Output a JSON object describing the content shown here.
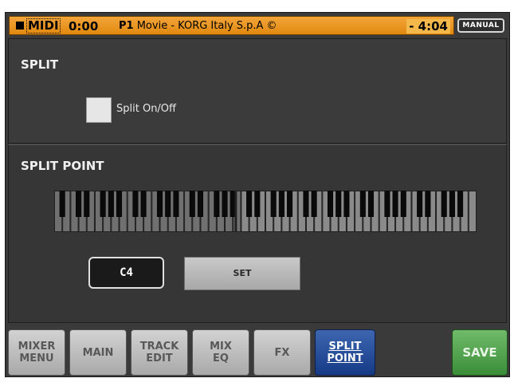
{
  "header": {
    "mode": "MIDI",
    "time": "0:00",
    "song_number": "P1",
    "song_title": "Movie - KORG Italy S.p.A ©",
    "remaining": "- 4:04",
    "manual_label": "MANUAL"
  },
  "split": {
    "title": "SPLIT",
    "checkbox_label": "Split On/Off",
    "checked": false
  },
  "split_point": {
    "title": "SPLIT POINT",
    "note_value": "C4",
    "set_label": "SET",
    "split_fraction": 0.43
  },
  "tabs": [
    {
      "label": "MIXER\nMENU",
      "active": false
    },
    {
      "label": "MAIN",
      "active": false
    },
    {
      "label": "TRACK\nEDIT",
      "active": false
    },
    {
      "label": "MIX\nEQ",
      "active": false
    },
    {
      "label": "FX",
      "active": false
    },
    {
      "label": "SPLIT\nPOINT",
      "active": true
    }
  ],
  "save_label": "SAVE",
  "colors": {
    "header_orange": "#e99a22",
    "active_tab": "#1f4590",
    "save_green": "#4c9e48",
    "panel_bg": "#3a3a3a"
  }
}
